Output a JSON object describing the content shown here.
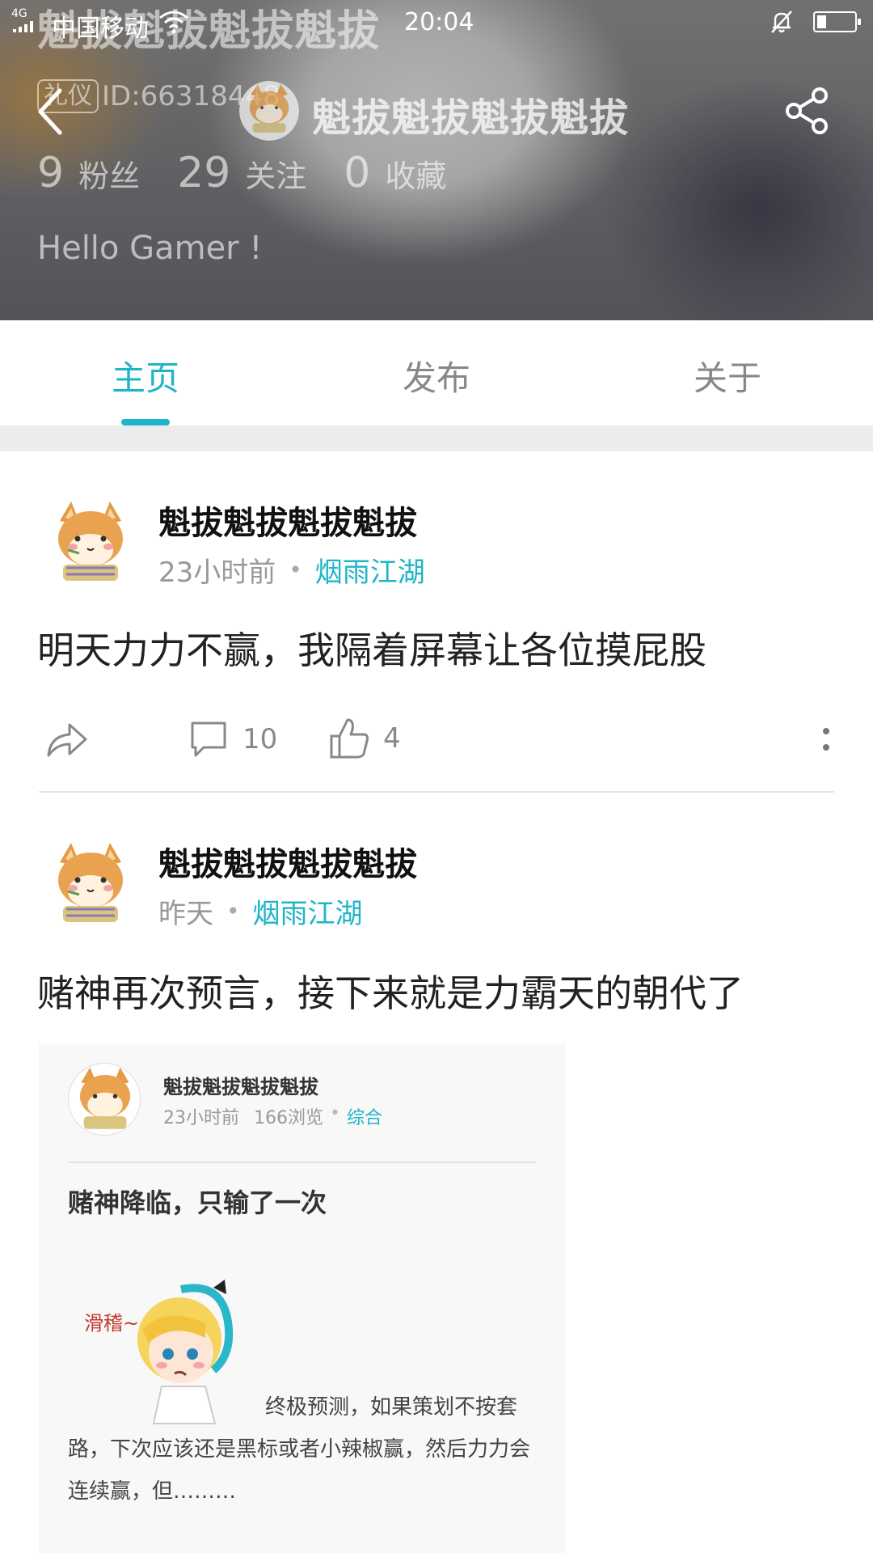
{
  "status_bar": {
    "network": "4G",
    "carrier": "中国移动",
    "time": "20:04",
    "battery_level": 0.25
  },
  "profile": {
    "ghost_title": "魁拔魁拔魁拔魁拔",
    "id_tag": "礼仪",
    "id_text": "ID:66318448",
    "name": "魁拔魁拔魁拔魁拔",
    "stats": [
      {
        "num": "9",
        "label": "粉丝"
      },
      {
        "num": "29",
        "label": "关注"
      },
      {
        "num": "0",
        "label": "收藏"
      }
    ],
    "bio": "Hello Gamer !"
  },
  "tabs": [
    {
      "label": "主页",
      "active": true
    },
    {
      "label": "发布",
      "active": false
    },
    {
      "label": "关于",
      "active": false
    }
  ],
  "posts": [
    {
      "author": "魁拔魁拔魁拔魁拔",
      "time": "23小时前",
      "topic": "烟雨江湖",
      "content": "明天力力不赢，我隔着屏幕让各位摸屁股",
      "comments": "10",
      "likes": "4"
    },
    {
      "author": "魁拔魁拔魁拔魁拔",
      "time": "昨天",
      "topic": "烟雨江湖",
      "content": "赌神再次预言，接下来就是力霸天的朝代了",
      "embed": {
        "author": "魁拔魁拔魁拔魁拔",
        "time": "23小时前",
        "views": "166浏览",
        "topic": "综合",
        "title": "赌神降临，只输了一次",
        "body": "终极预测，如果策划不按套路，下次应该还是黑标或者小辣椒赢，然后力力会连续赢，但………",
        "illustration_text": "滑稽~"
      }
    }
  ],
  "colors": {
    "accent": "#1fb5c8",
    "text": "#222222",
    "muted": "#999999"
  }
}
